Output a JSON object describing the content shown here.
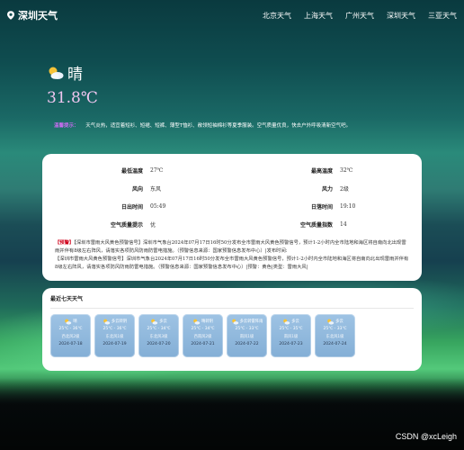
{
  "navbar": {
    "brand": "深圳天气",
    "links": [
      "北京天气",
      "上海天气",
      "广州天气",
      "深圳天气",
      "三亚天气"
    ]
  },
  "current": {
    "icon": "sun-cloud-icon",
    "condition": "晴",
    "temperature": "31.8℃"
  },
  "tip": {
    "label": "温馨提示：",
    "text": "天气炎热，适宜着短衫、短裙、短裤、薄型T恤衫、敞领短袖棉衫等夏季服装。空气质量优良，快去户外呼吸清新空气吧。"
  },
  "details": [
    {
      "k": "最低温度",
      "v": "27℃"
    },
    {
      "k": "最高温度",
      "v": "32℃"
    },
    {
      "k": "风向",
      "v": "东风"
    },
    {
      "k": "风力",
      "v": "2级"
    },
    {
      "k": "日出时间",
      "v": "05:49"
    },
    {
      "k": "日落时间",
      "v": "19:10"
    },
    {
      "k": "空气质量提示",
      "v": "优"
    },
    {
      "k": "空气质量指数",
      "v": "14"
    }
  ],
  "alerts": {
    "tag": "【预警】",
    "text": "【深圳市雷雨大风黄色预警信号】深圳市气象台2024年07月17日16时50分发布全市雷雨大风黄色预警信号，预计1-2小时内全市陆地和海区将自南向北出现雷雨并伴有8级左右阵风，请落实各项防风防雨防雷电措施。（预警信息来源：国家预警信息发布中心）|发布时间:",
    "text2": "【深圳市雷雨大风黄色预警信号】深圳市气象台2024年07月17日16时50分发布全市雷雨大风黄色预警信号，预计1-2小时内全市陆地和海区将自南向北出现雷雨并伴有8级左右阵风，请落实各项防风防雨防雷电措施。（预警信息来源：国家预警信息发布中心）|预警：黄色|类型：雷雨大风|"
  },
  "week": {
    "title": "最近七天天气",
    "days": [
      {
        "cond": "晴",
        "temp": "25℃ - 36℃",
        "wind": "西北风2级",
        "date": "2024-07-18",
        "icon": "sun-cloud-icon"
      },
      {
        "cond": "多云转阴",
        "temp": "25℃ - 36℃",
        "wind": "东北风1级",
        "date": "2024-07-19",
        "icon": "sun-cloud-icon"
      },
      {
        "cond": "多云",
        "temp": "25℃ - 34℃",
        "wind": "东北风3级",
        "date": "2024-07-20",
        "icon": "sun-cloud-icon"
      },
      {
        "cond": "晴转阴",
        "temp": "25℃ - 34℃",
        "wind": "西南风2级",
        "date": "2024-07-21",
        "icon": "sun-cloud-icon"
      },
      {
        "cond": "多云转雷阵雨",
        "temp": "25℃ - 33℃",
        "wind": "南风1级",
        "date": "2024-07-22",
        "icon": "sun-cloud-icon"
      },
      {
        "cond": "多云",
        "temp": "25℃ - 35℃",
        "wind": "南风1级",
        "date": "2024-07-23",
        "icon": "sun-cloud-icon"
      },
      {
        "cond": "多云",
        "temp": "25℃ - 33℃",
        "wind": "东北风1级",
        "date": "2024-07-24",
        "icon": "sun-cloud-icon"
      }
    ]
  },
  "watermark": "CSDN @xcLeigh"
}
